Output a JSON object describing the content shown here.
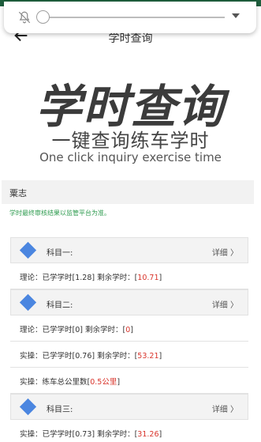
{
  "volume": {
    "level": 0.0,
    "icon": "bell-off-icon",
    "expand_icon": "chevron-down-icon"
  },
  "header": {
    "title": "学时查询",
    "back_icon": "arrow-left-icon"
  },
  "banner": {
    "title": "学时查询",
    "subtitle": "一键查询练车学时",
    "english": "One click inquiry exercise time"
  },
  "school": {
    "name": "粟志"
  },
  "notice": "学时最终审核结果以监管平台为准。",
  "subjects": [
    {
      "name": "科目一:",
      "detail": "详细 〉",
      "lines": [
        {
          "prefix": "理论：已学学时[1.28] 剩余学时：[",
          "value": "10.71",
          "suffix": "]"
        }
      ]
    },
    {
      "name": "科目二:",
      "detail": "详细 〉",
      "lines": [
        {
          "prefix": "理论：已学学时[0] 剩余学时：[",
          "value": "0",
          "suffix": "]"
        },
        {
          "prefix": "实操：已学学时[0.76] 剩余学时：[",
          "value": "53.21",
          "suffix": "]"
        },
        {
          "prefix": "实操：练车总公里数[",
          "value": "0.5公里",
          "suffix": "]"
        }
      ]
    },
    {
      "name": "科目三:",
      "detail": "详细 〉",
      "lines": [
        {
          "prefix": "实操：已学学时[0.73] 剩余学时：[",
          "value": "31.26",
          "suffix": "]"
        }
      ]
    }
  ],
  "colors": {
    "accent": "#4b86e0",
    "highlight": "#d9342b",
    "notice": "#2e9b4f",
    "status_bar": "#1f5f3d"
  }
}
